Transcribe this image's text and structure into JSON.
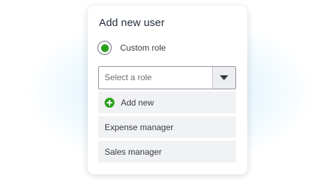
{
  "dialog": {
    "title": "Add new user"
  },
  "role_option": {
    "label": "Custom role",
    "selected": true,
    "accent_color": "#2ca01c"
  },
  "role_select": {
    "placeholder": "Select a role",
    "caret_icon": "chevron-down-icon",
    "options": [
      {
        "label": "Add new",
        "icon": "plus-circle-icon"
      },
      {
        "label": "Expense manager"
      },
      {
        "label": "Sales manager"
      }
    ]
  }
}
